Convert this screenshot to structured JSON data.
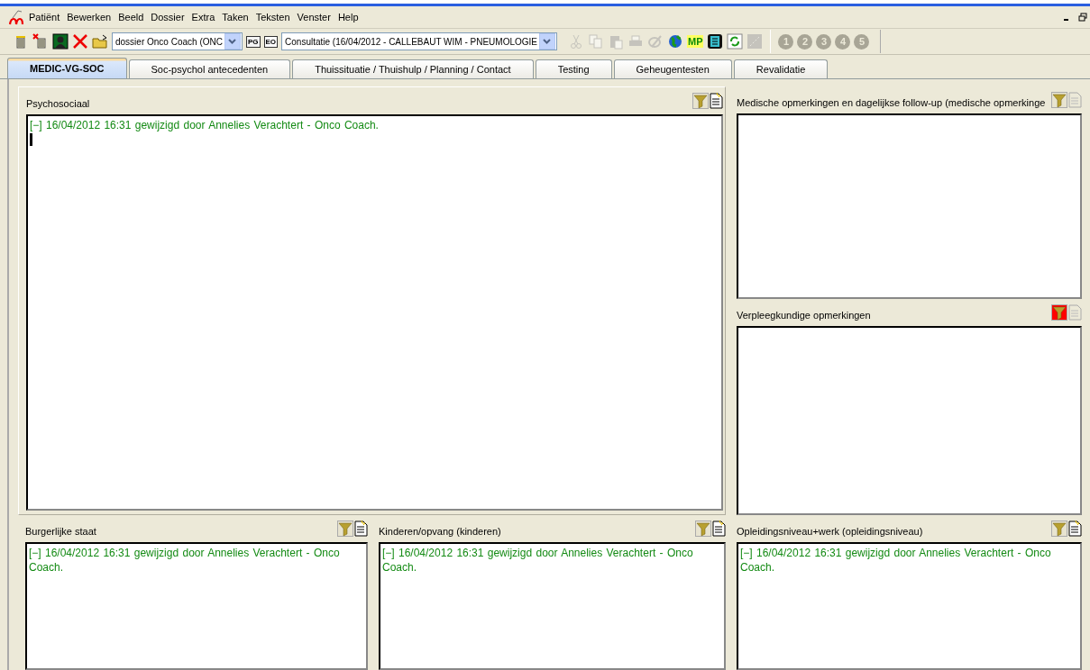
{
  "menu": [
    "Patiënt",
    "Bewerken",
    "Beeld",
    "Dossier",
    "Extra",
    "Taken",
    "Teksten",
    "Venster",
    "Help"
  ],
  "toolbar": {
    "left_icons": [
      {
        "kind": "bin",
        "disabled": false
      },
      {
        "kind": "bin-delete",
        "disabled": false
      },
      {
        "kind": "portrait",
        "disabled": false
      },
      {
        "kind": "cross",
        "disabled": false
      },
      {
        "kind": "folder",
        "disabled": false
      }
    ],
    "dossier": {
      "value": "dossier Onco Coach (ONC"
    },
    "mid_icons": [
      {
        "kind": "pg",
        "label": "PG"
      },
      {
        "kind": "eo",
        "label": "EO"
      }
    ],
    "consultatie": {
      "value": "Consultatie (16/04/2012 - CALLEBAUT WIM - PNEUMOLOGIE"
    },
    "right_icons": [
      {
        "kind": "scissors",
        "disabled": true
      },
      {
        "kind": "copy",
        "disabled": true
      },
      {
        "kind": "paste",
        "disabled": true
      },
      {
        "kind": "printer",
        "disabled": true
      },
      {
        "kind": "edit",
        "disabled": true
      },
      {
        "kind": "globe",
        "disabled": false
      },
      {
        "kind": "mp",
        "label": "MP",
        "disabled": false
      },
      {
        "kind": "document",
        "disabled": false
      },
      {
        "kind": "refresh",
        "disabled": false
      },
      {
        "kind": "resize",
        "disabled": true
      }
    ],
    "steps": [
      {
        "label": "1",
        "disabled": true
      },
      {
        "label": "2",
        "disabled": true
      },
      {
        "label": "3",
        "disabled": true
      },
      {
        "label": "4",
        "disabled": true
      },
      {
        "label": "5",
        "disabled": true
      }
    ]
  },
  "tabs": [
    {
      "label": "MEDIC-VG-SOC",
      "selected": true
    },
    {
      "label": "Soc-psychol antecedenten",
      "selected": false
    },
    {
      "label": "Thuissituatie / Thuishulp / Planning / Contact",
      "selected": false
    },
    {
      "label": "Testing",
      "selected": false
    },
    {
      "label": "Geheugentesten",
      "selected": false
    },
    {
      "label": "Revalidatie",
      "selected": false
    }
  ],
  "panels": [
    {
      "title": "Psychosociaal",
      "filter_active": false,
      "note_enabled": true,
      "text": "[−]  16/04/2012 16:31 gewijzigd door Annelies Verachtert - Onco Coach.",
      "cursor": true
    },
    {
      "title": "Medische opmerkingen en dagelijkse follow-up (medische opmerkinge",
      "filter_active": false,
      "note_enabled": false
    },
    {
      "title": "Verpleegkundige opmerkingen",
      "filter_active": true,
      "note_enabled": false
    },
    {
      "title": "Burgerlijke staat",
      "filter_active": false,
      "note_enabled": true,
      "text": "[−]  16/04/2012 16:31 gewijzigd door Annelies Verachtert - Onco Coach."
    },
    {
      "title": "Kinderen/opvang (kinderen)",
      "filter_active": false,
      "note_enabled": true,
      "text": "[−]  16/04/2012 16:31 gewijzigd door Annelies Verachtert - Onco Coach."
    },
    {
      "title": "Opleidingsniveau+werk (opleidingsniveau)",
      "filter_active": false,
      "note_enabled": true,
      "text": "[−]  16/04/2012 16:31 gewijzigd door Annelies Verachtert - Onco Coach."
    }
  ]
}
